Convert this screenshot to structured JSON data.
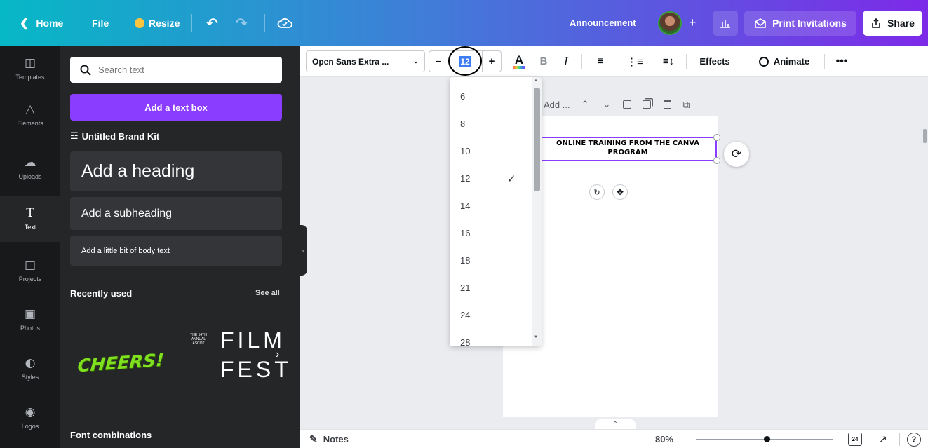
{
  "topbar": {
    "home_label": "Home",
    "file_label": "File",
    "resize_label": "Resize",
    "title": "Announcement",
    "print_label": "Print Invitations",
    "share_label": "Share"
  },
  "rail": [
    {
      "label": "Templates",
      "icon": "templates-icon"
    },
    {
      "label": "Elements",
      "icon": "elements-icon"
    },
    {
      "label": "Uploads",
      "icon": "uploads-icon"
    },
    {
      "label": "Text",
      "icon": "text-icon"
    },
    {
      "label": "Projects",
      "icon": "projects-icon"
    },
    {
      "label": "Photos",
      "icon": "photos-icon"
    },
    {
      "label": "Styles",
      "icon": "styles-icon"
    },
    {
      "label": "Logos",
      "icon": "logos-icon"
    }
  ],
  "panel": {
    "search_placeholder": "Search text",
    "add_textbox": "Add a text box",
    "brand_kit": "Untitled Brand Kit",
    "heading": "Add a heading",
    "subheading": "Add a subheading",
    "body": "Add a little bit of body text",
    "recently_used": "Recently used",
    "see_all": "See all",
    "cheers": "CHEERS!",
    "film_small": "THE 14TH ANNUAL ASCOT",
    "film_1": "FILM",
    "film_2": "FEST",
    "font_combinations": "Font combinations"
  },
  "toolbar": {
    "font_name": "Open Sans Extra ...",
    "font_size": "12",
    "effects": "Effects",
    "animate": "Animate"
  },
  "dropdown": {
    "options": [
      "6",
      "8",
      "10",
      "12",
      "14",
      "16",
      "18",
      "21",
      "24",
      "28"
    ],
    "selected": "12"
  },
  "canvas": {
    "page_toolbar_label": "Add ...",
    "text_line1": "ONLINE TRAINING FROM THE CANVA",
    "text_line2": "PROGRAM"
  },
  "bottombar": {
    "notes": "Notes",
    "zoom": "80%",
    "zoom_level": 0.8,
    "page_count": "24"
  },
  "colors": {
    "accent": "#8b3dff",
    "rail_bg": "#18191b",
    "panel_bg": "#252627",
    "cheers": "#7ee01e"
  }
}
